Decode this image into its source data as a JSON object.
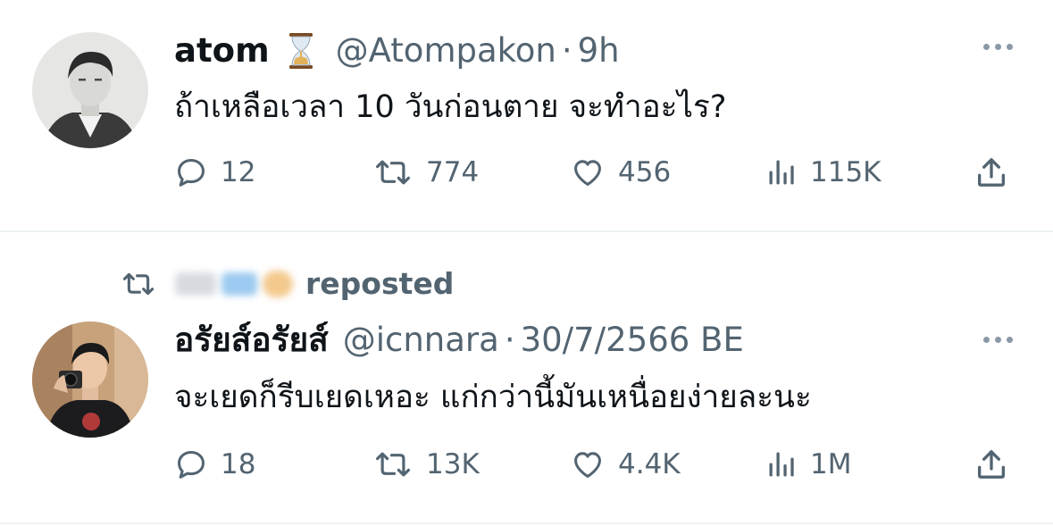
{
  "tweets": [
    {
      "author_name": "atom",
      "name_emoji": "hourglass-icon",
      "handle": "@Atompakon",
      "separator": "·",
      "time": "9h",
      "text": "ถ้าเหลือเวลา 10 วันก่อนตาย จะทำอะไร?",
      "reply_count": "12",
      "repost_count": "774",
      "like_count": "456",
      "view_count": "115K"
    },
    {
      "reposted_label": "reposted",
      "author_name": "อรัยส์อรัยส์",
      "handle": "@icnnara",
      "separator": "·",
      "time": "30/7/2566 BE",
      "text": "จะเยดก็รีบเยดเหอะ แก่กว่านี้มันเหนื่อยง่ายละนะ",
      "reply_count": "18",
      "repost_count": "13K",
      "like_count": "4.4K",
      "view_count": "1M"
    }
  ],
  "colors": {
    "text_primary": "#0f1419",
    "text_secondary": "#536471",
    "divider": "#eff3f4"
  }
}
